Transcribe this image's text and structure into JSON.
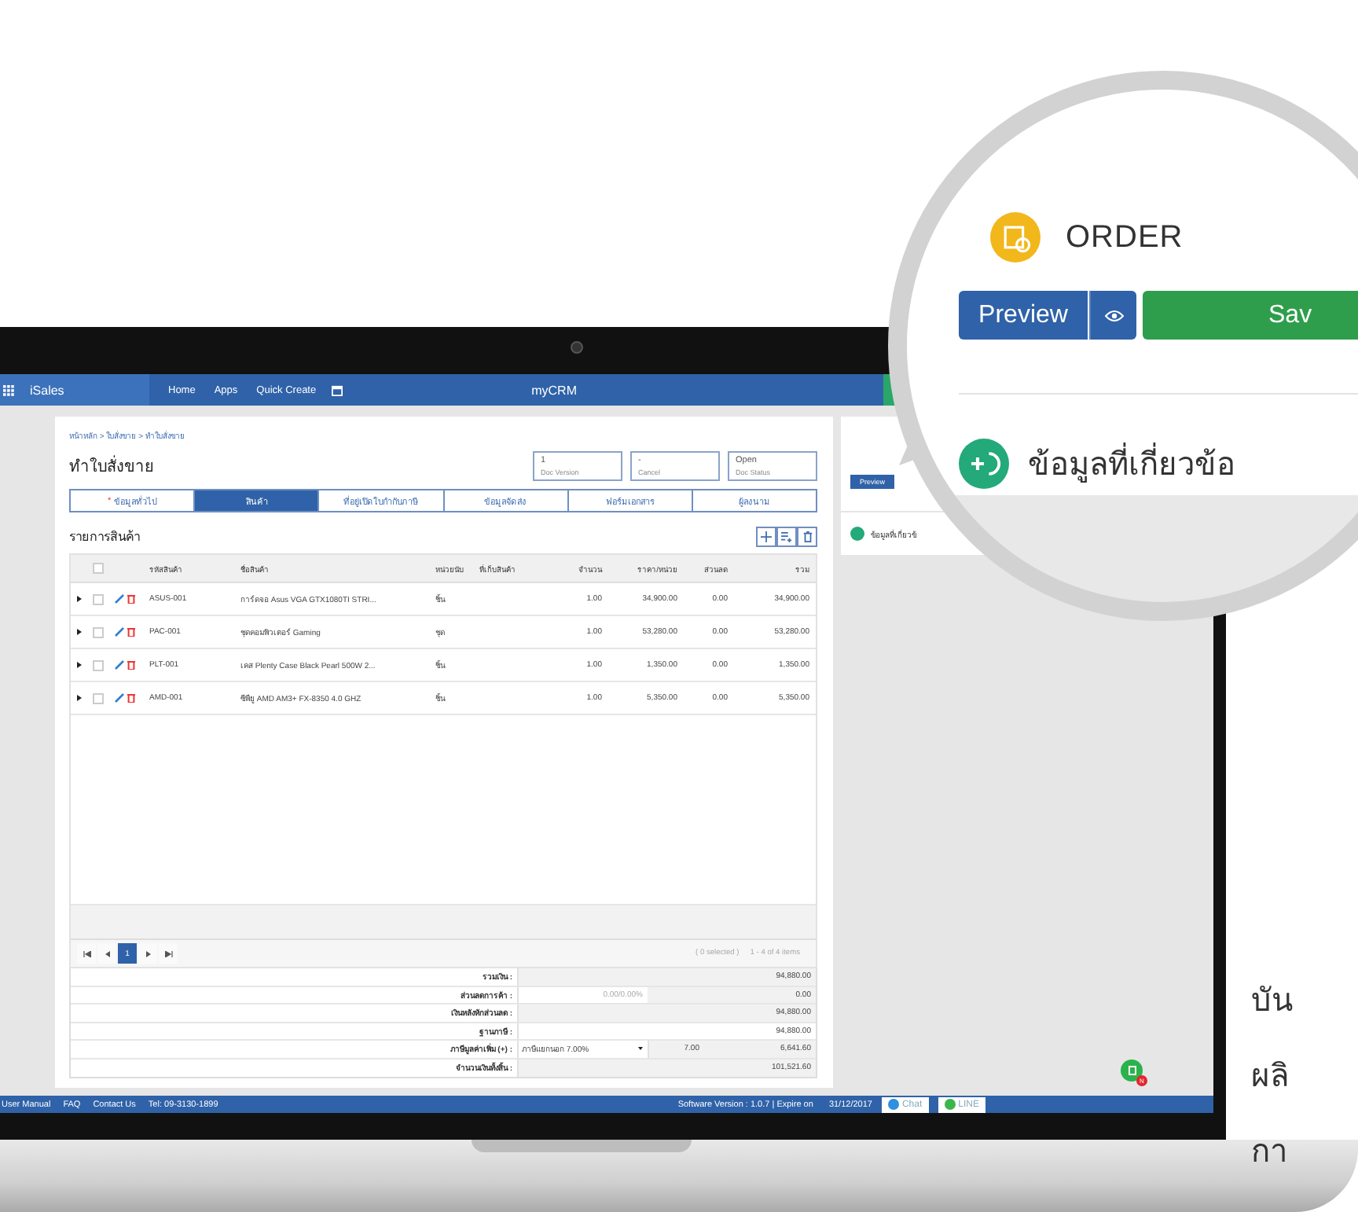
{
  "nav": {
    "brand": "iSales",
    "items": [
      "Home",
      "Apps",
      "Quick Create"
    ],
    "center": "myCRM"
  },
  "breadcrumb": "หน้าหลัก > ใบสั่งขาย > ทำใบสั่งขาย",
  "title": "ทำใบสั่งขาย",
  "doc_fields": [
    {
      "value": "1",
      "label": "Doc Version"
    },
    {
      "value": "-",
      "label": "Cancel"
    },
    {
      "value": "Open",
      "label": "Doc Status"
    }
  ],
  "tabs": [
    {
      "label": "ข้อมูลทั่วไป",
      "required_mark": "*",
      "selected": false
    },
    {
      "label": "สินค้า",
      "selected": true
    },
    {
      "label": "ที่อยู่เปิดใบกำกับภาษี",
      "selected": false
    },
    {
      "label": "ข้อมูลจัดส่ง",
      "selected": false
    },
    {
      "label": "ฟอร์มเอกสาร",
      "selected": false
    },
    {
      "label": "ผู้ลงนาม",
      "selected": false
    }
  ],
  "section_title": "รายการสินค้า",
  "table": {
    "all_checked": false,
    "columns": [
      "รหัสสินค้า",
      "ชื่อสินค้า",
      "หน่วยนับ",
      "ที่เก็บสินค้า",
      "จำนวน",
      "ราคา/หน่วย",
      "ส่วนลด",
      "รวม"
    ],
    "rows": [
      {
        "checked": false,
        "code": "ASUS-001",
        "name": "การ์ดจอ Asus VGA GTX1080TI STRI...",
        "unit": "ชิ้น",
        "qty": "1.00",
        "price": "34,900.00",
        "discount": "0.00",
        "total": "34,900.00"
      },
      {
        "checked": false,
        "code": "PAC-001",
        "name": "ชุดคอมพิวเตอร์ Gaming",
        "unit": "ชุด",
        "qty": "1.00",
        "price": "53,280.00",
        "discount": "0.00",
        "total": "53,280.00"
      },
      {
        "checked": false,
        "code": "PLT-001",
        "name": "เคส Plenty Case Black Pearl 500W 2...",
        "unit": "ชิ้น",
        "qty": "1.00",
        "price": "1,350.00",
        "discount": "0.00",
        "total": "1,350.00"
      },
      {
        "checked": false,
        "code": "AMD-001",
        "name": "ซีพียู AMD AM3+ FX-8350 4.0 GHZ",
        "unit": "ชิ้น",
        "qty": "1.00",
        "price": "5,350.00",
        "discount": "0.00",
        "total": "5,350.00"
      }
    ]
  },
  "pager": {
    "pages": [
      {
        "label": "1",
        "selected": true
      }
    ],
    "selected_info": "( 0 selected )",
    "range": "1 - 4 of 4 items"
  },
  "totals": [
    {
      "kind": "plain",
      "label": "รวมเงิน :",
      "value": "94,880.00"
    },
    {
      "kind": "discount",
      "label": "ส่วนลดการค้า :",
      "input": "0.00/0.00%",
      "value": "0.00"
    },
    {
      "kind": "plain",
      "label": "เงินหลังหักส่วนลด :",
      "value": "94,880.00"
    },
    {
      "kind": "open",
      "label": "ฐานภาษี :",
      "value": "94,880.00"
    },
    {
      "kind": "vat",
      "label": "ภาษีมูลค่าเพิ่ม (+) :",
      "select": "ภาษีแยกนอก 7.00%",
      "rate": "7.00",
      "value": "6,641.60"
    },
    {
      "kind": "plain",
      "label": "จำนวนเงินทั้งสิ้น :",
      "value": "101,521.60"
    }
  ],
  "side_panel": {
    "preview": "Preview",
    "related": "ข้อมูลที่เกี่ยวข้"
  },
  "notification": {
    "badge": "N"
  },
  "footer": {
    "links": [
      "User Manual",
      "FAQ",
      "Contact Us",
      "Tel: 09-3130-1899"
    ],
    "version": "Software Version : 1.0.7 | Expire on",
    "date": "31/12/2017",
    "chat": "Chat",
    "line": "LINE"
  },
  "magnifier": {
    "title": "ORDER",
    "preview": "Preview",
    "save": "Sav",
    "related": "ข้อมูลที่เกี่ยวข้อ"
  },
  "side_text": [
    "บัน",
    "ผลิ",
    "กา"
  ]
}
